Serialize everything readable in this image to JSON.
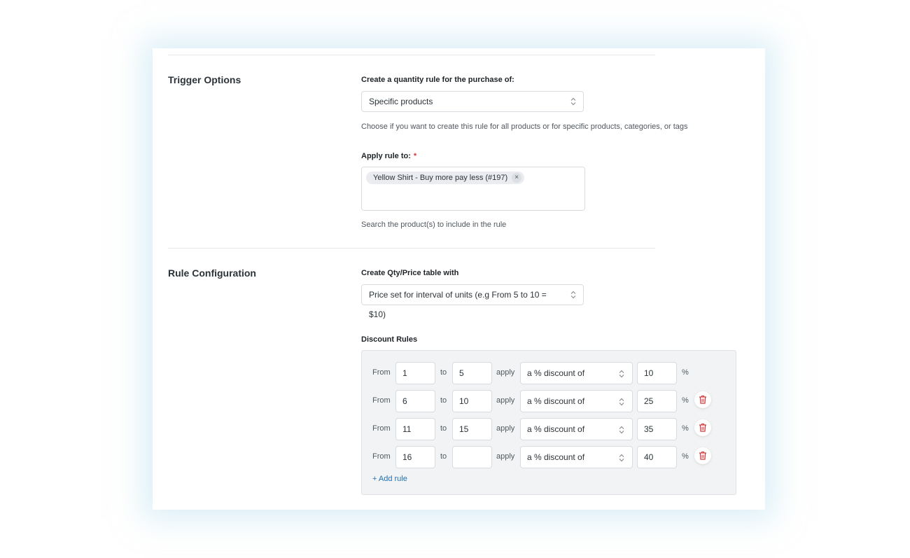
{
  "trigger": {
    "section_title": "Trigger Options",
    "purchase_label": "Create a quantity rule for the purchase of:",
    "purchase_value": "Specific products",
    "purchase_help": "Choose if you want to create this rule for all products or for specific products, categories, or tags",
    "apply_label": "Apply rule to:",
    "required_mark": "*",
    "chip_label": "Yellow Shirt - Buy more pay less (#197)",
    "chip_remove": "×",
    "search_help": "Search the product(s) to include in the rule"
  },
  "config": {
    "section_title": "Rule Configuration",
    "table_label": "Create Qty/Price table with",
    "table_value": "Price set for interval of units (e.g From 5 to 10 = $10)",
    "discount_label": "Discount Rules"
  },
  "rules": [
    {
      "from_text": "From",
      "from": "1",
      "to_text": "to",
      "to": "5",
      "apply_text": "apply",
      "type": "a % discount of",
      "amount": "10",
      "unit": "%",
      "deletable": false
    },
    {
      "from_text": "From",
      "from": "6",
      "to_text": "to",
      "to": "10",
      "apply_text": "apply",
      "type": "a % discount of",
      "amount": "25",
      "unit": "%",
      "deletable": true
    },
    {
      "from_text": "From",
      "from": "11",
      "to_text": "to",
      "to": "15",
      "apply_text": "apply",
      "type": "a % discount of",
      "amount": "35",
      "unit": "%",
      "deletable": true
    },
    {
      "from_text": "From",
      "from": "16",
      "to_text": "to",
      "to": "",
      "apply_text": "apply",
      "type": "a % discount of",
      "amount": "40",
      "unit": "%",
      "deletable": true
    }
  ],
  "add_rule_label": "+ Add rule",
  "icons": {
    "select_arrows": "chevron-up-down-icon",
    "delete": "trash-icon"
  },
  "colors": {
    "accent_link": "#2271b1",
    "delete_red": "#d63638",
    "required_red": "#d63638"
  }
}
